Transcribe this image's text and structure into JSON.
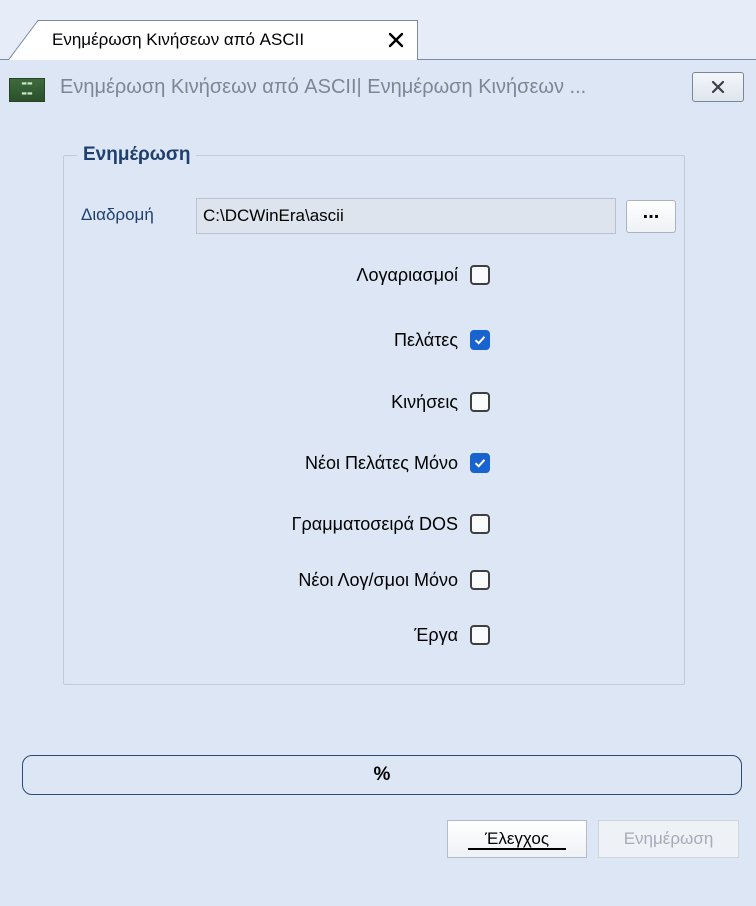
{
  "tab": {
    "label": "Ενημέρωση Κινήσεων από ASCII",
    "close_icon": "close-x-icon"
  },
  "window": {
    "title": "Ενημέρωση Κινήσεων από ASCII| Ενημέρωση Κινήσεων ...",
    "app_icon": "app-logo-icon",
    "close_icon": "close-x-icon"
  },
  "group": {
    "title": "Ενημέρωση",
    "path_label": "Διαδρομή",
    "path_value": "C:\\DCWinEra\\ascii",
    "browse_label": "..."
  },
  "options": [
    {
      "label": "Λογαριασμοί",
      "checked": false
    },
    {
      "label": "Πελάτες",
      "checked": true
    },
    {
      "label": "Κινήσεις",
      "checked": false
    },
    {
      "label": "Νέοι Πελάτες Μόνο",
      "checked": true
    },
    {
      "label": "Γραμματοσειρά DOS",
      "checked": false
    },
    {
      "label": "Νέοι Λογ/σμοι Μόνο",
      "checked": false
    },
    {
      "label": "Έργα",
      "checked": false
    }
  ],
  "progress": {
    "text": "%",
    "value": 0
  },
  "buttons": {
    "check_label": "Έλεγχος",
    "update_label": "Ενημέρωση",
    "update_enabled": false
  },
  "colors": {
    "background": "#dce6f4",
    "accent": "#1863d0",
    "group_title": "#1f3f6e",
    "disabled_text": "#a4acb8"
  }
}
